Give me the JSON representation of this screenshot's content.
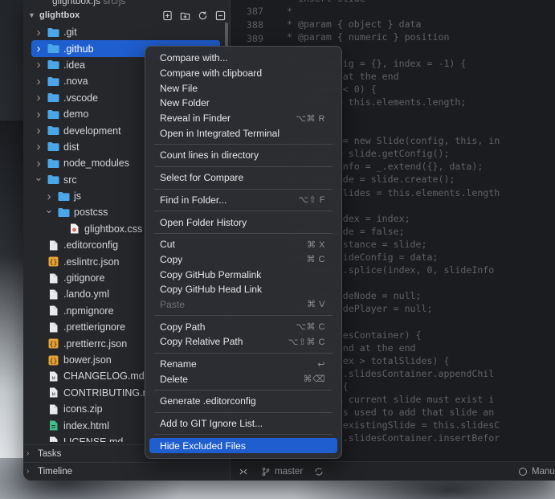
{
  "window": {
    "open_file_name": "glightbox.js",
    "open_file_path": "src/js"
  },
  "project": {
    "title": "glightbox",
    "actions": [
      {
        "name": "new-file-icon"
      },
      {
        "name": "new-folder-icon"
      },
      {
        "name": "refresh-icon"
      },
      {
        "name": "collapse-all-icon"
      }
    ]
  },
  "tree": [
    {
      "label": ".git",
      "type": "folder",
      "depth": 0,
      "chevron": "right"
    },
    {
      "label": ".github",
      "type": "folder",
      "depth": 0,
      "chevron": "right",
      "selected": true
    },
    {
      "label": ".idea",
      "type": "folder",
      "depth": 0,
      "chevron": "right"
    },
    {
      "label": ".nova",
      "type": "folder",
      "depth": 0,
      "chevron": "right"
    },
    {
      "label": ".vscode",
      "type": "folder",
      "depth": 0,
      "chevron": "right"
    },
    {
      "label": "demo",
      "type": "folder",
      "depth": 0,
      "chevron": "right"
    },
    {
      "label": "development",
      "type": "folder",
      "depth": 0,
      "chevron": "right"
    },
    {
      "label": "dist",
      "type": "folder",
      "depth": 0,
      "chevron": "right"
    },
    {
      "label": "node_modules",
      "type": "folder",
      "depth": 0,
      "chevron": "right"
    },
    {
      "label": "src",
      "type": "folder",
      "depth": 0,
      "chevron": "down"
    },
    {
      "label": "js",
      "type": "folder",
      "depth": 1,
      "chevron": "right"
    },
    {
      "label": "postcss",
      "type": "folder",
      "depth": 1,
      "chevron": "down"
    },
    {
      "label": "glightbox.css",
      "type": "css",
      "depth": 2,
      "chevron": ""
    },
    {
      "label": ".editorconfig",
      "type": "file",
      "depth": 0,
      "chevron": ""
    },
    {
      "label": ".eslintrc.json",
      "type": "json",
      "depth": 0,
      "chevron": ""
    },
    {
      "label": ".gitignore",
      "type": "file",
      "depth": 0,
      "chevron": ""
    },
    {
      "label": ".lando.yml",
      "type": "file",
      "depth": 0,
      "chevron": ""
    },
    {
      "label": ".npmignore",
      "type": "file",
      "depth": 0,
      "chevron": ""
    },
    {
      "label": ".prettierignore",
      "type": "file",
      "depth": 0,
      "chevron": ""
    },
    {
      "label": ".prettierrc.json",
      "type": "json",
      "depth": 0,
      "chevron": ""
    },
    {
      "label": "bower.json",
      "type": "json",
      "depth": 0,
      "chevron": ""
    },
    {
      "label": "CHANGELOG.md",
      "type": "md",
      "depth": 0,
      "chevron": ""
    },
    {
      "label": "CONTRIBUTING.md",
      "type": "md",
      "depth": 0,
      "chevron": ""
    },
    {
      "label": "icons.zip",
      "type": "file",
      "depth": 0,
      "chevron": ""
    },
    {
      "label": "index.html",
      "type": "html",
      "depth": 0,
      "chevron": ""
    },
    {
      "label": "LICENSE.md",
      "type": "md",
      "depth": 0,
      "chevron": ""
    }
  ],
  "sections": {
    "tasks": "Tasks",
    "timeline": "Timeline"
  },
  "editor": {
    "line_numbers": [
      "387",
      "388",
      "389"
    ],
    "code_lines": [
      "* insert slide",
      "*",
      "* @param { object } data",
      "* @param { numeric } position",
      "*/",
      "Slide(config = {}, index = -1) {",
      "   Append at the end",
      "   (index < 0) {",
      "   index = this.elements.length;",
      "",
      "",
      "nst slide = new Slide(config, this, in",
      "nst data = slide.getConfig();",
      "nst slideInfo = _.extend({}, data);",
      "nst newSlide = slide.create();",
      "nst totalSlides = this.elements.length",
      "",
      "ideInfo.index = index;",
      "ideInfo.node = false;",
      "ideInfo.instance = slide;",
      "ideInfo.slideConfig = data;",
      "s.elements.splice(index, 0, slideInfo",
      "",
      "t addedSlideNode = null;",
      "t addedSlidePlayer = null;",
      "",
      "(this.slidesContainer) {",
      "   // Append at the end",
      "   if (index > totalSlides) {",
      "      this.slidesContainer.appendChil",
      "   } else {",
      "      // A current slide must exist i",
      "      // is used to add that slide an",
      "      let existingSlide = this.slidesC",
      "      this.slidesContainer.insertBefor",
      "   }"
    ]
  },
  "statusbar": {
    "branch": "master",
    "right_label": "Manu"
  },
  "context_menu": {
    "groups": [
      [
        {
          "label": "Compare with...",
          "shortcut": ""
        },
        {
          "label": "Compare with clipboard",
          "shortcut": ""
        },
        {
          "label": "New File",
          "shortcut": ""
        },
        {
          "label": "New Folder",
          "shortcut": ""
        },
        {
          "label": "Reveal in Finder",
          "shortcut": "⌥⌘ R"
        },
        {
          "label": "Open in Integrated Terminal",
          "shortcut": ""
        }
      ],
      [
        {
          "label": "Count lines in directory",
          "shortcut": ""
        }
      ],
      [
        {
          "label": "Select for Compare",
          "shortcut": ""
        }
      ],
      [
        {
          "label": "Find in Folder...",
          "shortcut": "⌥⇧ F"
        }
      ],
      [
        {
          "label": "Open Folder History",
          "shortcut": ""
        }
      ],
      [
        {
          "label": "Cut",
          "shortcut": "⌘ X"
        },
        {
          "label": "Copy",
          "shortcut": "⌘ C"
        },
        {
          "label": "Copy GitHub Permalink",
          "shortcut": ""
        },
        {
          "label": "Copy GitHub Head Link",
          "shortcut": ""
        },
        {
          "label": "Paste",
          "shortcut": "⌘ V",
          "disabled": true
        }
      ],
      [
        {
          "label": "Copy Path",
          "shortcut": "⌥⌘ C"
        },
        {
          "label": "Copy Relative Path",
          "shortcut": "⌥⇧⌘ C"
        }
      ],
      [
        {
          "label": "Rename",
          "shortcut": "↩"
        },
        {
          "label": "Delete",
          "shortcut": "⌘⌫"
        }
      ],
      [
        {
          "label": "Generate .editorconfig",
          "shortcut": ""
        }
      ],
      [
        {
          "label": "Add to GIT Ignore List...",
          "shortcut": ""
        }
      ],
      [
        {
          "label": "Hide Excluded Files",
          "shortcut": "",
          "highlight": true
        }
      ]
    ]
  },
  "colors": {
    "accent": "#1f5ecf",
    "folder": "#4aa8ea",
    "json": "#e7a235",
    "html": "#3fbd8a",
    "css": "#e06c5a"
  }
}
